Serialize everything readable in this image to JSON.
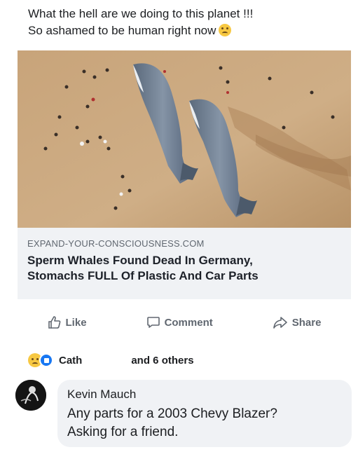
{
  "post": {
    "text_line1": "What the hell are we doing to this planet !!!",
    "text_line2": "So ashamed to be human right now",
    "emoji": "grimacing-sad-emoji"
  },
  "link_card": {
    "image_description_icon": "whale-photo",
    "domain": "EXPAND-YOUR-CONSCIOUSNESS.COM",
    "title_line1": "Sperm Whales Found Dead In Germany,",
    "title_line2": "Stomachs FULL Of Plastic And Car Parts"
  },
  "actions": {
    "like": "Like",
    "comment": "Comment",
    "share": "Share"
  },
  "reactions": {
    "name": "Cath",
    "others": "and 6 others"
  },
  "comment": {
    "author": "Kevin Mauch",
    "body_line1": "Any parts for a 2003 Chevy Blazer?",
    "body_line2": "Asking for a friend."
  },
  "colors": {
    "text": "#1c1e21",
    "muted": "#606770",
    "card_bg": "#f0f2f5",
    "sand": "#c9a57c",
    "whale": "#6d7d8f"
  }
}
